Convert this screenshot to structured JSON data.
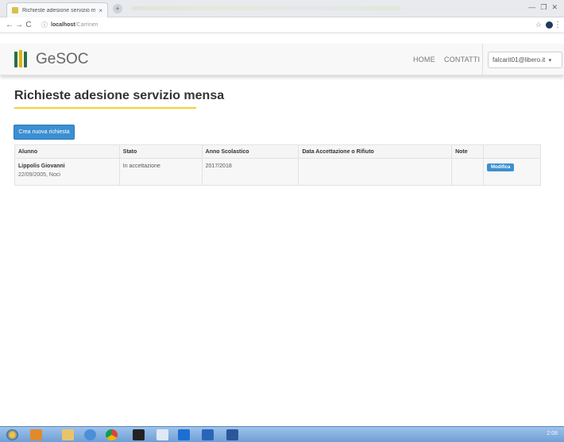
{
  "browser": {
    "tab_title": "Richieste adesione servizio mens",
    "tab_close": "×",
    "new_tab": "+",
    "window_controls": [
      "—",
      "❐",
      "✕"
    ],
    "nav_back": "←",
    "nav_forward": "→",
    "nav_reload": "C",
    "info_glyph": "ⓘ",
    "address_host": "localhost",
    "address_path": "/Carrinen",
    "star_glyph": "☆",
    "menu_glyph": "⋮"
  },
  "navbar": {
    "brand": "GeSOC",
    "links": [
      "HOME",
      "CONTATTI"
    ],
    "user_email": "falcarit01@libero.it",
    "user_caret": "▾"
  },
  "page": {
    "title": "Richieste adesione servizio mensa",
    "new_button": "Crea nuova richiesta"
  },
  "table": {
    "headers": [
      "Alunno",
      "Stato",
      "Anno Scolastico",
      "Data Accettazione o Rifiuto",
      "Note",
      ""
    ],
    "rows": [
      {
        "alunno_name": "Lippolis Giovanni",
        "alunno_sub": "22/09/2005, Noci",
        "stato": "In accettazione",
        "anno": "2017/2018",
        "data": "",
        "note": "",
        "action": "Modifica"
      }
    ]
  },
  "taskbar": {
    "tray_text": "2:08"
  },
  "colors": {
    "primary": "#3b8fd2",
    "accent_yellow": "#f3d037",
    "brand_green": "#2c6e49"
  }
}
